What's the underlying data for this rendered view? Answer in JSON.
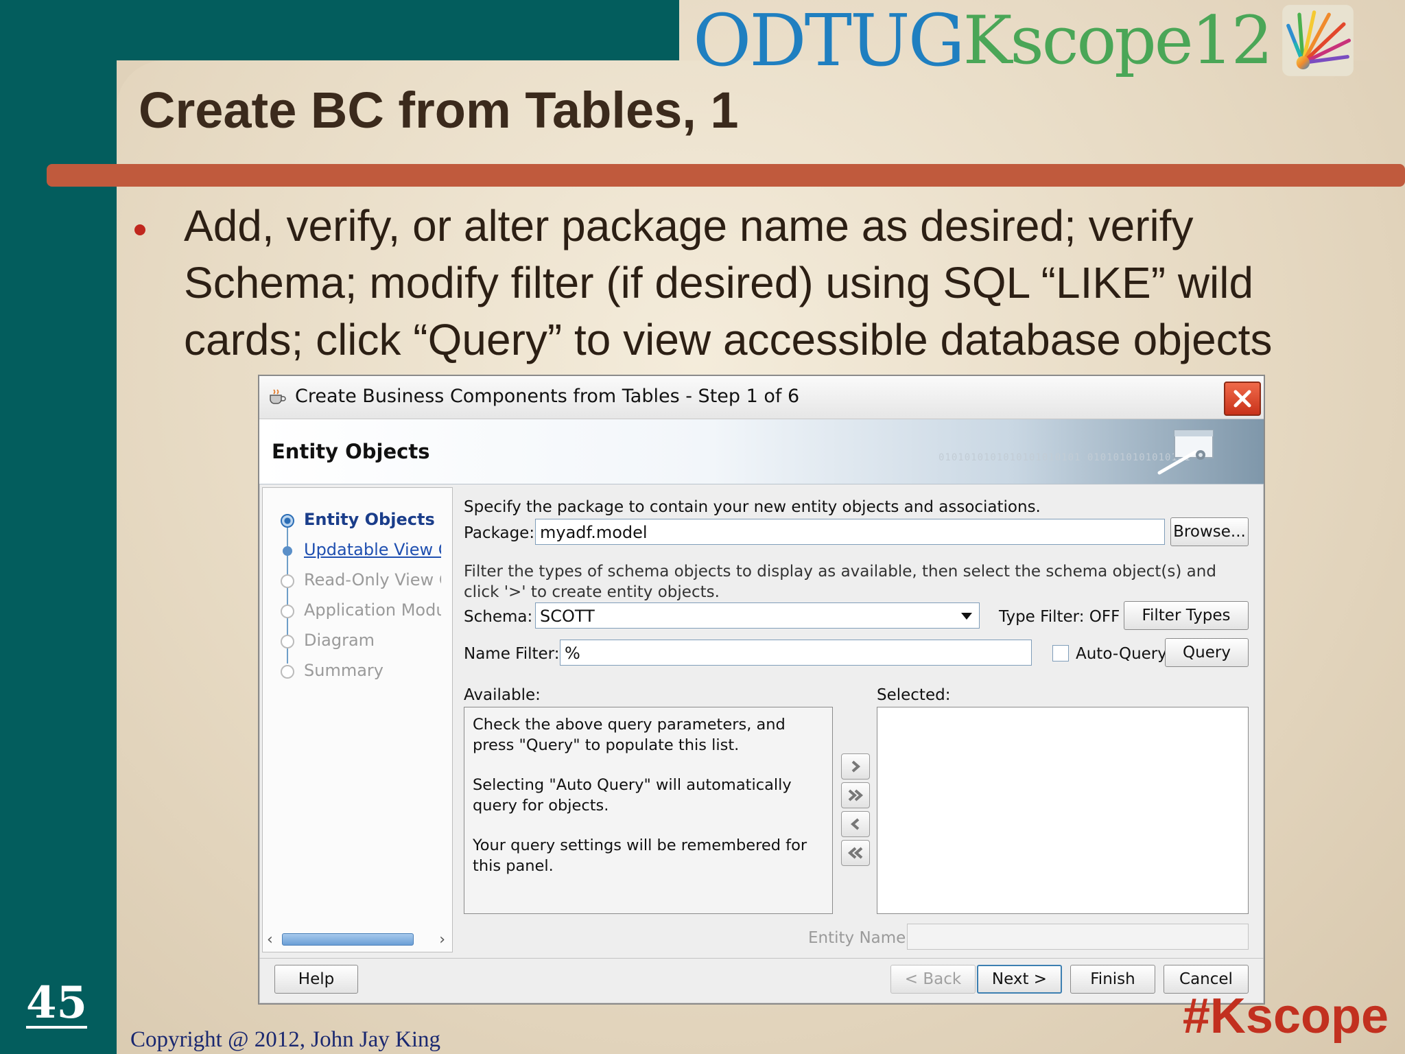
{
  "slide": {
    "logo_odtug": "ODTUG",
    "logo_kscope": "Kscope12",
    "title": "Create BC from Tables, 1",
    "bullet": "Add, verify, or alter package name as desired; verify Schema; modify filter (if desired) using SQL “LIKE” wild cards; click “Query” to view accessible database objects",
    "slide_number": "45",
    "copyright": "Copyright @ 2012, John Jay King",
    "hashtag": "#Kscope",
    "colors": {
      "teal": "#035d5d",
      "rule": "#c05a3d",
      "hashtag": "#c2301f"
    }
  },
  "dialog": {
    "title": "Create Business Components from Tables - Step 1 of 6",
    "header_title": "Entity Objects",
    "header_binary": "0101010101010101010101 0101010101010101",
    "nav": [
      {
        "label": "Entity Objects",
        "state": "active"
      },
      {
        "label": "Updatable View Objects",
        "state": "link"
      },
      {
        "label": "Read-Only View Objects",
        "state": "disabled"
      },
      {
        "label": "Application Module",
        "state": "disabled"
      },
      {
        "label": "Diagram",
        "state": "disabled"
      },
      {
        "label": "Summary",
        "state": "disabled"
      }
    ],
    "package_instructions": "Specify the package to contain your new entity objects and associations.",
    "package_label": "Package:",
    "package_value": "myadf.model",
    "browse_label": "Browse...",
    "filter_instructions": "Filter the types of schema objects to display as available, then select the schema object(s) and click '>' to create entity objects.",
    "schema_label": "Schema:",
    "schema_value": "SCOTT",
    "type_filter_label": "Type Filter: OFF",
    "filter_types_label": "Filter Types",
    "name_filter_label": "Name Filter:",
    "name_filter_value": "%",
    "auto_query_label": "Auto-Query",
    "auto_query_checked": false,
    "query_label": "Query",
    "available_label": "Available:",
    "selected_label": "Selected:",
    "available_msg_1": "Check the above query parameters, and press \"Query\" to populate this list.",
    "available_msg_2": "Selecting \"Auto Query\" will automatically query for objects.",
    "available_msg_3": "Your query settings will be remembered for this panel.",
    "entity_name_label": "Entity Name:",
    "entity_name_value": "",
    "buttons": {
      "help": "Help",
      "back": "< Back",
      "next": "Next >",
      "finish": "Finish",
      "cancel": "Cancel"
    }
  }
}
